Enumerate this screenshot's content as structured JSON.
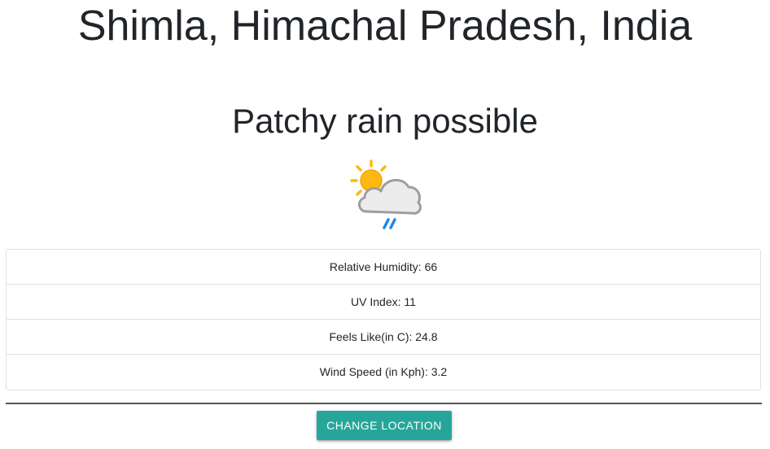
{
  "location": {
    "title": "Shimla, Himachal Pradesh, India"
  },
  "condition": {
    "text": "Patchy rain possible",
    "icon": "sun-cloud-rain-icon"
  },
  "stats": [
    {
      "label": "Relative Humidity: 66"
    },
    {
      "label": "UV Index: 11"
    },
    {
      "label": "Feels Like(in C): 24.8"
    },
    {
      "label": "Wind Speed (in Kph): 3.2"
    }
  ],
  "actions": {
    "change_location_label": "Change Location"
  },
  "colors": {
    "accent": "#26a69a",
    "sun": "#fdb813",
    "cloud": "#e8e8e8",
    "rain": "#1e88e5"
  }
}
